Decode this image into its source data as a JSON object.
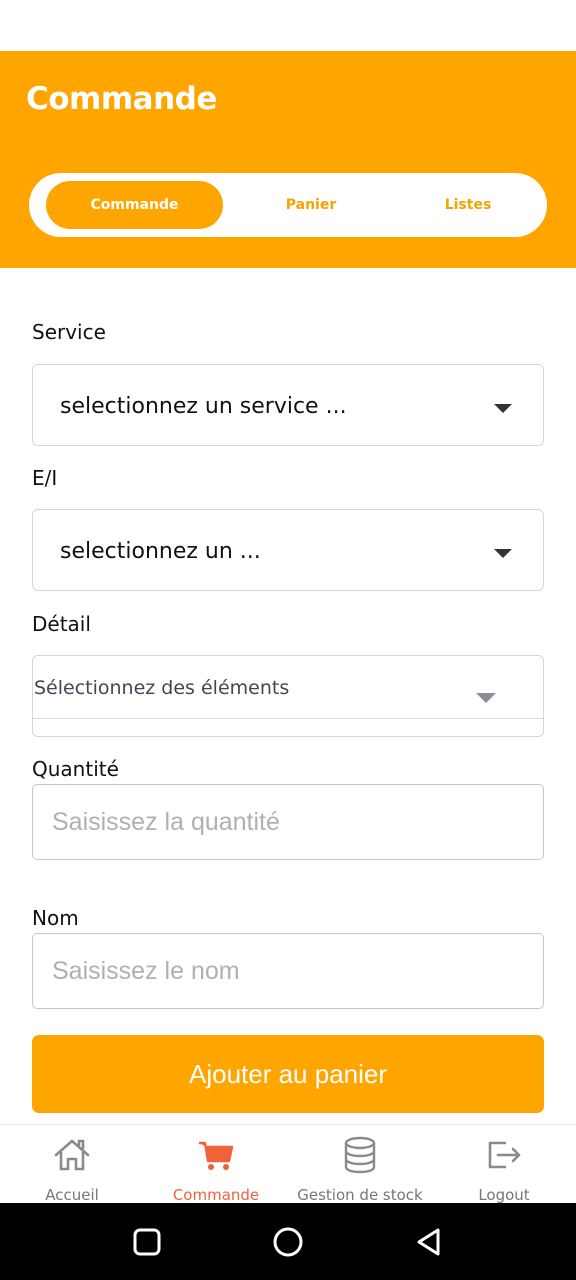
{
  "header": {
    "title": "Commande"
  },
  "tabs_top": [
    {
      "label": "Commande",
      "active": true
    },
    {
      "label": "Panier",
      "active": false
    },
    {
      "label": "Listes",
      "active": false
    }
  ],
  "form": {
    "service": {
      "label": "Service",
      "value": "selectionnez un service ..."
    },
    "ei": {
      "label": "E/I",
      "value": "selectionnez un ..."
    },
    "detail": {
      "label": "Détail",
      "placeholder": "Sélectionnez des éléments"
    },
    "quantite": {
      "label": "Quantité",
      "placeholder": "Saisissez la quantité"
    },
    "nom": {
      "label": "Nom",
      "placeholder": "Saisissez le nom"
    },
    "submit_label": "Ajouter au panier"
  },
  "bottom_nav": [
    {
      "label": "Accueil",
      "icon": "home-icon",
      "active": false
    },
    {
      "label": "Commande",
      "icon": "cart-icon",
      "active": true
    },
    {
      "label": "Gestion de stock",
      "icon": "database-icon",
      "active": false
    },
    {
      "label": "Logout",
      "icon": "logout-icon",
      "active": false
    }
  ],
  "colors": {
    "accent": "#FFA500",
    "active_tab": "#F0623A",
    "inactive_tab": "#777777"
  }
}
